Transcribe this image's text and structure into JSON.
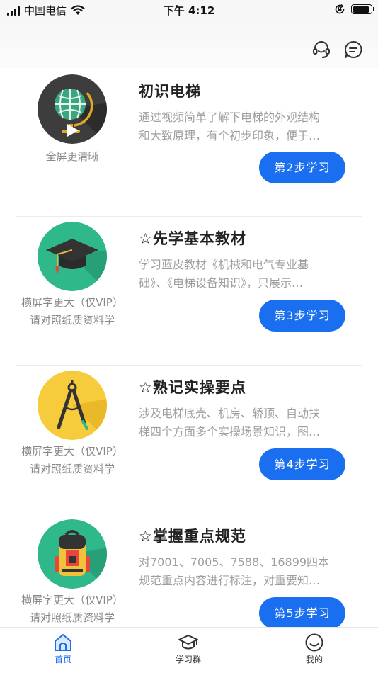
{
  "status_bar": {
    "carrier": "中国电信",
    "time": "下午 4:12"
  },
  "header": {
    "support_icon": "headset-icon",
    "message_icon": "message-icon"
  },
  "lessons": [
    {
      "title": "初识电梯",
      "desc_line1": "通过视频简单了解下电梯的外观结构",
      "desc_line2": "和大致原理，有个初步印象，便于…",
      "caption_line1": "全屏更清晰",
      "caption_line2": "",
      "button": "第2步学习",
      "icon": "globe-play-icon",
      "color": "#3d3d3d"
    },
    {
      "title": "☆先学基本教材",
      "desc_line1": "学习蓝皮教材《机械和电气专业基",
      "desc_line2": "础》、《电梯设备知识》，只展示…",
      "caption_line1": "横屏字更大（仅VIP）",
      "caption_line2": "请对照纸质资料学",
      "button": "第3步学习",
      "icon": "graduation-cap-icon",
      "color": "#2fb98a"
    },
    {
      "title": "☆熟记实操要点",
      "desc_line1": "涉及电梯底壳、机房、轿顶、自动扶",
      "desc_line2": "梯四个方面多个实操场景知识，图…",
      "caption_line1": "横屏字更大（仅VIP）",
      "caption_line2": "请对照纸质资料学",
      "button": "第4步学习",
      "icon": "compass-icon",
      "color": "#f7cc3c"
    },
    {
      "title": "☆掌握重点规范",
      "desc_line1": "对7001、7005、7588、16899四本",
      "desc_line2": "规范重点内容进行标注，对重要知…",
      "caption_line1": "横屏字更大（仅VIP）",
      "caption_line2": "请对照纸质资料学",
      "button": "第5步学习",
      "icon": "backpack-icon",
      "color": "#2fb98a"
    }
  ],
  "tab_bar": {
    "items": [
      {
        "label": "首页",
        "icon": "home-icon",
        "active": true
      },
      {
        "label": "学习群",
        "icon": "graduation-cap-icon",
        "active": false
      },
      {
        "label": "我的",
        "icon": "smile-face-icon",
        "active": false
      }
    ],
    "accent": "#1a6ef0"
  }
}
